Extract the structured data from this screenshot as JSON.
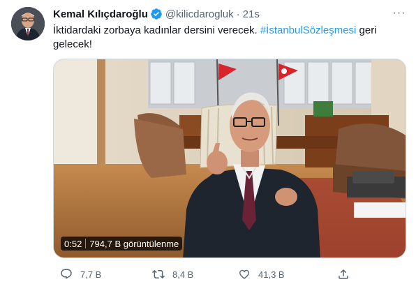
{
  "tweet": {
    "author_name": "Kemal Kılıçdaroğlu",
    "handle": "@kilicdarogluk",
    "separator": "·",
    "time": "21s",
    "text_before": "İktidardaki zorbaya kadınlar dersini verecek. ",
    "hashtag": "#İstanbulSözleşmesi",
    "text_after": " geri gelecek!",
    "more_label": "···"
  },
  "video": {
    "duration": "0:52",
    "views": "794,7 B görüntülenme"
  },
  "actions": {
    "reply_count": "7,7 B",
    "retweet_count": "8,4 B",
    "like_count": "41,3 B",
    "share_label": ""
  },
  "colors": {
    "accent": "#1d9bf0",
    "muted": "#536471",
    "text": "#0f1419"
  }
}
